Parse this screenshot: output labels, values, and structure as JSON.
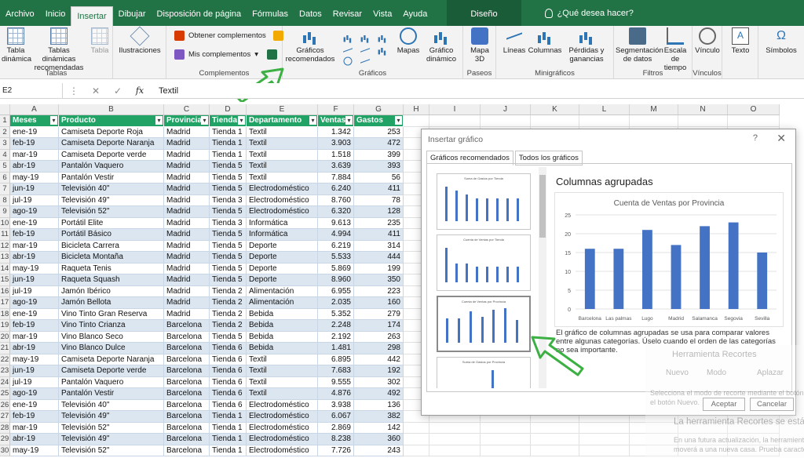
{
  "ribbon": {
    "tabs": [
      {
        "label": "Archivo",
        "active": false
      },
      {
        "label": "Inicio",
        "active": false
      },
      {
        "label": "Insertar",
        "active": true
      },
      {
        "label": "Dibujar",
        "active": false
      },
      {
        "label": "Disposición de página",
        "active": false
      },
      {
        "label": "Fórmulas",
        "active": false
      },
      {
        "label": "Datos",
        "active": false
      },
      {
        "label": "Revisar",
        "active": false
      },
      {
        "label": "Vista",
        "active": false
      },
      {
        "label": "Ayuda",
        "active": false
      }
    ],
    "context_tab": "Diseño",
    "tell_me": "¿Qué desea hacer?",
    "groups": {
      "tablas": {
        "label": "Tablas",
        "btn1": "Tabla dinámica",
        "btn2": "Tablas dinámicas recomendadas",
        "btn3": "Tabla"
      },
      "ilustraciones": {
        "btn": "Ilustraciones"
      },
      "complementos": {
        "label": "Complementos",
        "get": "Obtener complementos",
        "mine": "Mis complementos"
      },
      "graficos": {
        "label": "Gráficos",
        "recommended": "Gráficos recomendados",
        "maps": "Mapas",
        "pivot_chart": "Gráfico dinámico"
      },
      "paseos": {
        "label": "Paseos",
        "map3d": "Mapa 3D"
      },
      "minigraficos": {
        "label": "Minigráficos",
        "lines": "Líneas",
        "columns": "Columnas",
        "winloss": "Pérdidas y ganancias"
      },
      "filtros": {
        "label": "Filtros",
        "slicer": "Segmentación de datos",
        "timeline": "Escala de tiempo"
      },
      "vinculos": {
        "label": "Vínculos",
        "link": "Vínculo"
      },
      "texto": {
        "btn": "Texto"
      },
      "simbolos": {
        "btn": "Símbolos"
      }
    }
  },
  "formula_bar": {
    "name_box": "E2",
    "fx": "fx",
    "value": "Textil"
  },
  "columns": [
    "A",
    "B",
    "C",
    "D",
    "E",
    "F",
    "G",
    "H",
    "I",
    "J",
    "K",
    "L",
    "M",
    "N",
    "O"
  ],
  "table": {
    "headers": [
      "Meses",
      "Producto",
      "Provincia",
      "Tienda",
      "Departamento",
      "Ventas",
      "Gastos"
    ],
    "rows": [
      [
        "ene-19",
        "Camiseta Deporte Roja",
        "Madrid",
        "Tienda 1",
        "Textil",
        "1.342",
        "253"
      ],
      [
        "feb-19",
        "Camiseta Deporte Naranja",
        "Madrid",
        "Tienda 1",
        "Textil",
        "3.903",
        "472"
      ],
      [
        "mar-19",
        "Camiseta Deporte verde",
        "Madrid",
        "Tienda 1",
        "Textil",
        "1.518",
        "399"
      ],
      [
        "abr-19",
        "Pantalón Vaquero",
        "Madrid",
        "Tienda 5",
        "Textil",
        "3.639",
        "393"
      ],
      [
        "may-19",
        "Pantalón Vestir",
        "Madrid",
        "Tienda 5",
        "Textil",
        "7.884",
        "56"
      ],
      [
        "jun-19",
        "Televisión 40\"",
        "Madrid",
        "Tienda 5",
        "Electrodoméstico",
        "6.240",
        "411"
      ],
      [
        "jul-19",
        "Televisión 49\"",
        "Madrid",
        "Tienda 3",
        "Electrodoméstico",
        "8.760",
        "78"
      ],
      [
        "ago-19",
        "Televisión 52\"",
        "Madrid",
        "Tienda 5",
        "Electrodoméstico",
        "6.320",
        "128"
      ],
      [
        "ene-19",
        "Portátil Elite",
        "Madrid",
        "Tienda 3",
        "Informática",
        "9.613",
        "235"
      ],
      [
        "feb-19",
        "Portátil Básico",
        "Madrid",
        "Tienda 5",
        "Informática",
        "4.994",
        "411"
      ],
      [
        "mar-19",
        "Bicicleta Carrera",
        "Madrid",
        "Tienda 5",
        "Deporte",
        "6.219",
        "314"
      ],
      [
        "abr-19",
        "Bicicleta Montaña",
        "Madrid",
        "Tienda 5",
        "Deporte",
        "5.533",
        "444"
      ],
      [
        "may-19",
        "Raqueta Tenis",
        "Madrid",
        "Tienda 5",
        "Deporte",
        "5.869",
        "199"
      ],
      [
        "jun-19",
        "Raqueta Squash",
        "Madrid",
        "Tienda 5",
        "Deporte",
        "8.960",
        "350"
      ],
      [
        "jul-19",
        "Jamón Ibérico",
        "Madrid",
        "Tienda 2",
        "Alimentación",
        "6.955",
        "223"
      ],
      [
        "ago-19",
        "Jamón Bellota",
        "Madrid",
        "Tienda 2",
        "Alimentación",
        "2.035",
        "160"
      ],
      [
        "ene-19",
        "Vino Tinto Gran Reserva",
        "Madrid",
        "Tienda 2",
        "Bebida",
        "5.352",
        "279"
      ],
      [
        "feb-19",
        "Vino Tinto Crianza",
        "Barcelona",
        "Tienda 2",
        "Bebida",
        "2.248",
        "174"
      ],
      [
        "mar-19",
        "Vino Blanco Seco",
        "Barcelona",
        "Tienda 5",
        "Bebida",
        "2.192",
        "263"
      ],
      [
        "abr-19",
        "Vino Blanco Dulce",
        "Barcelona",
        "Tienda 6",
        "Bebida",
        "1.481",
        "298"
      ],
      [
        "may-19",
        "Camiseta Deporte Naranja",
        "Barcelona",
        "Tienda 6",
        "Textil",
        "6.895",
        "442"
      ],
      [
        "jun-19",
        "Camiseta Deporte verde",
        "Barcelona",
        "Tienda 6",
        "Textil",
        "7.683",
        "192"
      ],
      [
        "jul-19",
        "Pantalón Vaquero",
        "Barcelona",
        "Tienda 6",
        "Textil",
        "9.555",
        "302"
      ],
      [
        "ago-19",
        "Pantalón Vestir",
        "Barcelona",
        "Tienda 6",
        "Textil",
        "4.876",
        "492"
      ],
      [
        "ene-19",
        "Televisión 40\"",
        "Barcelona",
        "Tienda 6",
        "Electrodoméstico",
        "3.938",
        "136"
      ],
      [
        "feb-19",
        "Televisión 49\"",
        "Barcelona",
        "Tienda 1",
        "Electrodoméstico",
        "6.067",
        "382"
      ],
      [
        "mar-19",
        "Televisión 52\"",
        "Barcelona",
        "Tienda 1",
        "Electrodoméstico",
        "2.869",
        "142"
      ],
      [
        "abr-19",
        "Televisión 49\"",
        "Barcelona",
        "Tienda 1",
        "Electrodoméstico",
        "8.238",
        "360"
      ],
      [
        "may-19",
        "Televisión 52\"",
        "Barcelona",
        "Tienda 1",
        "Electrodoméstico",
        "7.726",
        "243"
      ]
    ]
  },
  "dialog": {
    "title": "Insertar gráfico",
    "help": "?",
    "close": "✕",
    "tabs": [
      "Gráficos recomendados",
      "Todos los gráficos"
    ],
    "thumbnails": [
      {
        "title": "Suma de Gastos por Tienda",
        "values": [
          9,
          8,
          7,
          6,
          6,
          6,
          6,
          6
        ]
      },
      {
        "title": "Cuenta de Ventas por Tienda",
        "values": [
          9,
          5,
          5,
          4,
          4,
          4,
          4,
          4
        ]
      },
      {
        "title": "Cuenta de Ventas por Provincia",
        "values": [
          16,
          16,
          21,
          17,
          22,
          23,
          15
        ]
      },
      {
        "title": "Suma de Gastos por Provincia",
        "values": [
          2,
          2,
          3,
          3,
          9,
          4,
          3
        ]
      }
    ],
    "preview_title": "Columnas agrupadas",
    "description": "El gráfico de columnas agrupadas se usa para comparar valores entre algunas categorías. Úselo cuando el orden de las categorías no sea importante.",
    "ok": "Aceptar",
    "cancel": "Cancelar"
  },
  "chart_data": {
    "type": "bar",
    "title": "Cuenta de Ventas por Provincia",
    "categories": [
      "Barcelona",
      "Las palmas",
      "Lugo",
      "Madrid",
      "Salamanca",
      "Segovia",
      "Sevilla"
    ],
    "values": [
      16,
      16,
      21,
      17,
      22,
      23,
      15
    ],
    "ylim": [
      0,
      25
    ],
    "yticks": [
      0,
      5,
      10,
      15,
      20,
      25
    ],
    "grid": true,
    "bar_color": "#4472c4"
  },
  "snip_tool": {
    "title": "Herramienta Recortes",
    "new": "Nuevo",
    "mode": "Modo",
    "delay": "Aplazar",
    "hint": "Selecciona el modo de recorte mediante el botón",
    "hint2": "el botón Nuevo.",
    "moving": "La herramienta Recortes se está",
    "future": "En una futura actualización, la herramienta",
    "future2": "moverá a una nueva casa. Prueba caracter"
  },
  "colors": {
    "excel_green": "#217346",
    "header_green": "#21a366",
    "band_blue": "#dce6f1",
    "arrow_green": "#3cb043"
  }
}
